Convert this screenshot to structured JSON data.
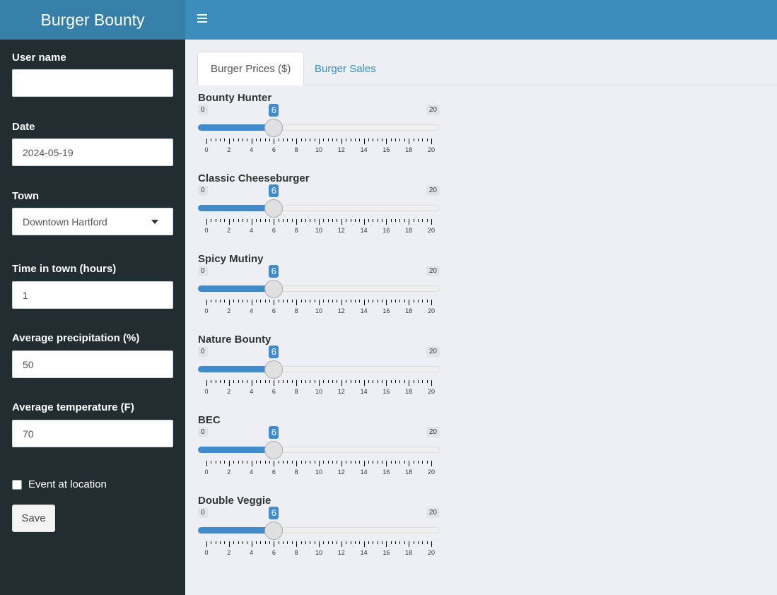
{
  "app": {
    "title": "Burger Bounty"
  },
  "sidebar": {
    "user_name": {
      "label": "User name",
      "value": ""
    },
    "date": {
      "label": "Date",
      "value": "2024-05-19"
    },
    "town": {
      "label": "Town",
      "value": "Downtown Hartford"
    },
    "time_in_town": {
      "label": "Time in town (hours)",
      "value": "1"
    },
    "precipitation": {
      "label": "Average precipitation (%)",
      "value": "50"
    },
    "temperature": {
      "label": "Average temperature (F)",
      "value": "70"
    },
    "event": {
      "label": "Event at location",
      "checked": false
    },
    "save_label": "Save"
  },
  "tabs": [
    {
      "label": "Burger Prices ($)",
      "active": true
    },
    {
      "label": "Burger Sales",
      "active": false
    }
  ],
  "slider_scale": {
    "min": 0,
    "max": 20,
    "min_label": "0",
    "max_label": "20",
    "ticks": [
      "0",
      "2",
      "4",
      "6",
      "8",
      "10",
      "12",
      "14",
      "16",
      "18",
      "20"
    ]
  },
  "sliders": [
    {
      "label": "Bounty Hunter",
      "value": 6
    },
    {
      "label": "Classic Cheeseburger",
      "value": 6
    },
    {
      "label": "Spicy Mutiny",
      "value": 6
    },
    {
      "label": "Nature Bounty",
      "value": 6
    },
    {
      "label": "BEC",
      "value": 6
    },
    {
      "label": "Double Veggie",
      "value": 6
    }
  ]
}
